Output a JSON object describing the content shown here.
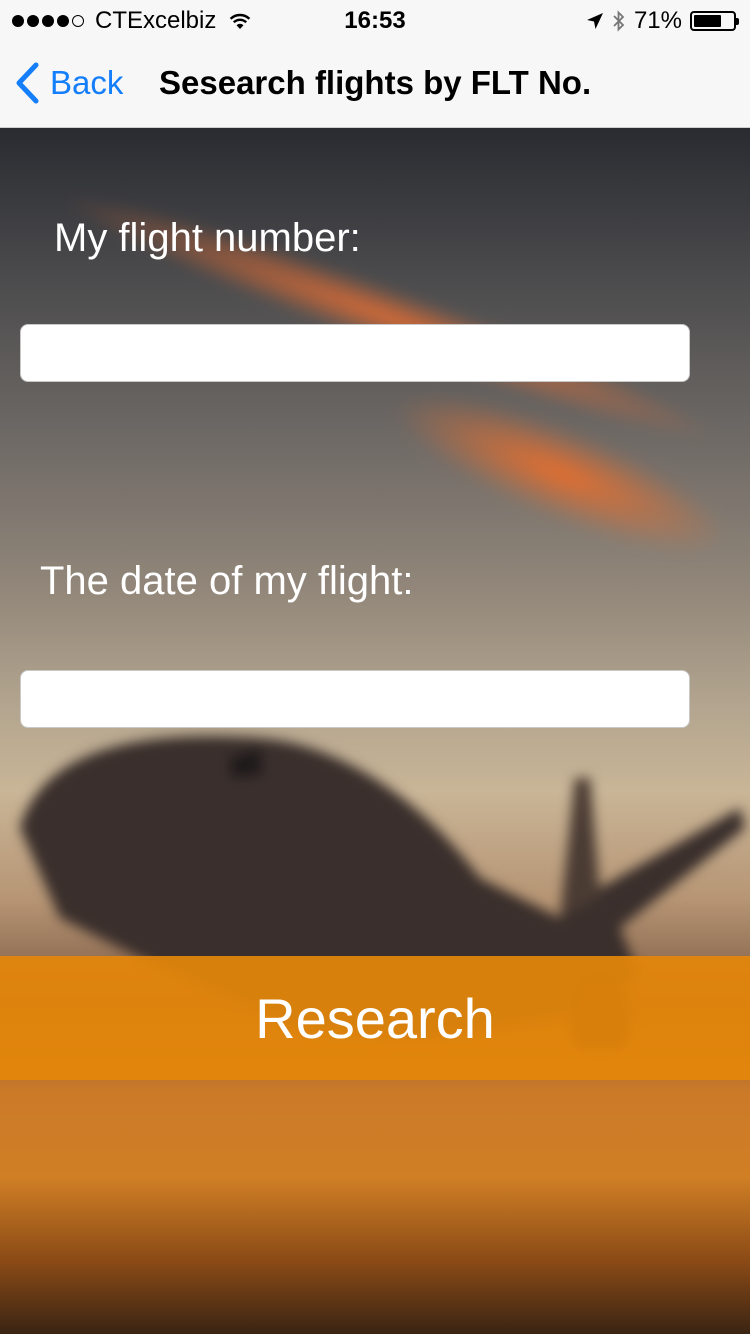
{
  "status_bar": {
    "signal_dots": [
      true,
      true,
      true,
      true,
      false
    ],
    "carrier": "CTExcelbiz",
    "time": "16:53",
    "battery_percent": "71%",
    "battery_level": 0.71,
    "icons": [
      "wifi-icon",
      "location-arrow-icon",
      "bluetooth-icon",
      "battery-icon"
    ]
  },
  "nav": {
    "back_label": "Back",
    "title": "Sesearch flights by FLT No."
  },
  "form": {
    "flight_number_label": "My flight number:",
    "flight_number_value": "",
    "date_label": "The date of my flight:",
    "date_value": "",
    "submit_label": "Research"
  },
  "colors": {
    "accent_blue": "#157efb",
    "button_orange": "#e4860a"
  }
}
